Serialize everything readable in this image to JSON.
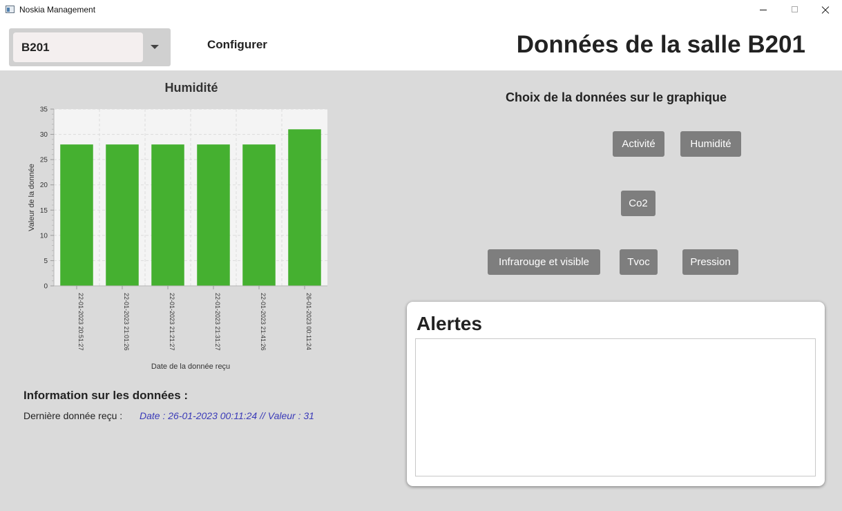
{
  "window": {
    "title": "Noskia Management"
  },
  "header": {
    "room_select": {
      "value": "B201"
    },
    "configure_label": "Configurer",
    "page_title": "Données de la salle B201"
  },
  "chart_section": {
    "title": "Humidité"
  },
  "chart_data": {
    "type": "bar",
    "title": "Humidité",
    "xlabel": "Date de la donnée reçu",
    "ylabel": "Valeur de la donnée",
    "categories": [
      "22-01-2023 20:51:27",
      "22-01-2023 21:01:26",
      "22-01-2023 21:21:27",
      "22-01-2023 21:31:27",
      "22-01-2023 21:41:26",
      "26-01-2023 00:11:24"
    ],
    "values": [
      28,
      28,
      28,
      28,
      28,
      31
    ],
    "ylim": [
      0,
      35
    ],
    "yticks": [
      0,
      5,
      10,
      15,
      20,
      25,
      30,
      35
    ],
    "grid": true,
    "bar_color": "#45b030"
  },
  "info": {
    "title": "Information sur les données :",
    "last_label": "Dernière donnée reçu :",
    "last_value": "Date : 26-01-2023 00:11:24 // Valeur  : 31"
  },
  "data_choice": {
    "title": "Choix de la données sur le graphique",
    "buttons": {
      "activite": "Activité",
      "humidite": "Humidité",
      "co2": "Co2",
      "infrarouge": "Infrarouge et visible",
      "tvoc": "Tvoc",
      "pression": "Pression"
    }
  },
  "alerts": {
    "title": "Alertes",
    "content": ""
  },
  "colors": {
    "background": "#dadada",
    "button": "#7e7e7e",
    "info_value": "#3a3ab8"
  }
}
